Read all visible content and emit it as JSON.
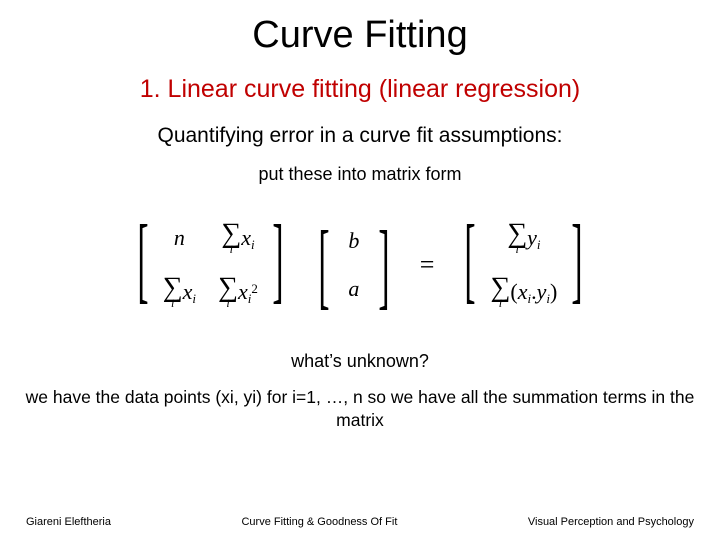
{
  "title": "Curve Fitting",
  "subtitle": "1. Linear curve fitting (linear regression)",
  "line1": "Quantifying error in a curve fit assumptions:",
  "line2": "put these into matrix form",
  "eq": {
    "A": {
      "a11": "n",
      "a12_var": "x",
      "a12_sub": "i",
      "a21_var": "x",
      "a21_sub": "i",
      "a22_var": "x",
      "a22_sub": "i",
      "a22_sup": "2",
      "sum_sub": "i"
    },
    "vec": {
      "top": "b",
      "bot": "a"
    },
    "equals": "=",
    "rhs": {
      "r1_var": "y",
      "r1_sub": "i",
      "r2_a": "x",
      "r2_a_sub": "i",
      "r2_b": "y",
      "r2_b_sub": "i",
      "sum_sub": "i",
      "lpar": "(",
      "rpar": ")",
      "dot": "."
    }
  },
  "question": "what’s unknown?",
  "explain": "we have the data points (xi, yi) for i=1, …, n so we have all the summation terms in the matrix",
  "footer": {
    "left": "Giareni Eleftheria",
    "center": "Curve Fitting & Goodness Of Fit",
    "right": "Visual Perception and Psychology"
  }
}
